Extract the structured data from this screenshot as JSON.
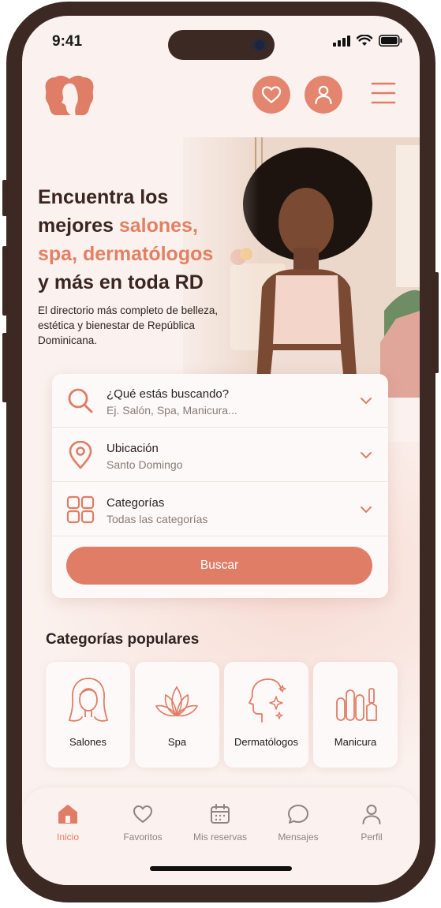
{
  "status_bar": {
    "time": "9:41"
  },
  "hero": {
    "title_line1": "Encuentra los",
    "title_line2_plain": "mejores ",
    "title_line2_accent": "salones,",
    "title_line3_accent": "spa, dermatólogos",
    "title_line4": "y más en toda RD",
    "subtitle": "El directorio más completo de belleza, estética y bienestar de República Dominicana."
  },
  "search": {
    "fields": [
      {
        "label": "¿Qué estás buscando?",
        "value": "Ej. Salón, Spa, Manicura...",
        "icon": "search-icon"
      },
      {
        "label": "Ubicación",
        "value": "Santo Domingo",
        "icon": "location-pin-icon"
      },
      {
        "label": "Categorías",
        "value": "Todas las categorías",
        "icon": "grid-icon"
      }
    ],
    "button_label": "Buscar"
  },
  "popular": {
    "title": "Categorías populares",
    "items": [
      {
        "label": "Salones",
        "icon": "hair-woman-icon"
      },
      {
        "label": "Spa",
        "icon": "lotus-icon"
      },
      {
        "label": "Dermatólogos",
        "icon": "face-sparkle-icon"
      },
      {
        "label": "Manicura",
        "icon": "nail-polish-icon"
      }
    ]
  },
  "tabbar": {
    "items": [
      {
        "label": "Inicio",
        "icon": "home-icon",
        "active": true
      },
      {
        "label": "Favoritos",
        "icon": "heart-icon"
      },
      {
        "label": "Mis reservas",
        "icon": "calendar-icon"
      },
      {
        "label": "Mensajes",
        "icon": "chat-icon"
      },
      {
        "label": "Perfil",
        "icon": "user-icon"
      }
    ]
  },
  "colors": {
    "accent": "#e07d66",
    "frame": "#3d2923",
    "background": "#fbf2ef"
  }
}
